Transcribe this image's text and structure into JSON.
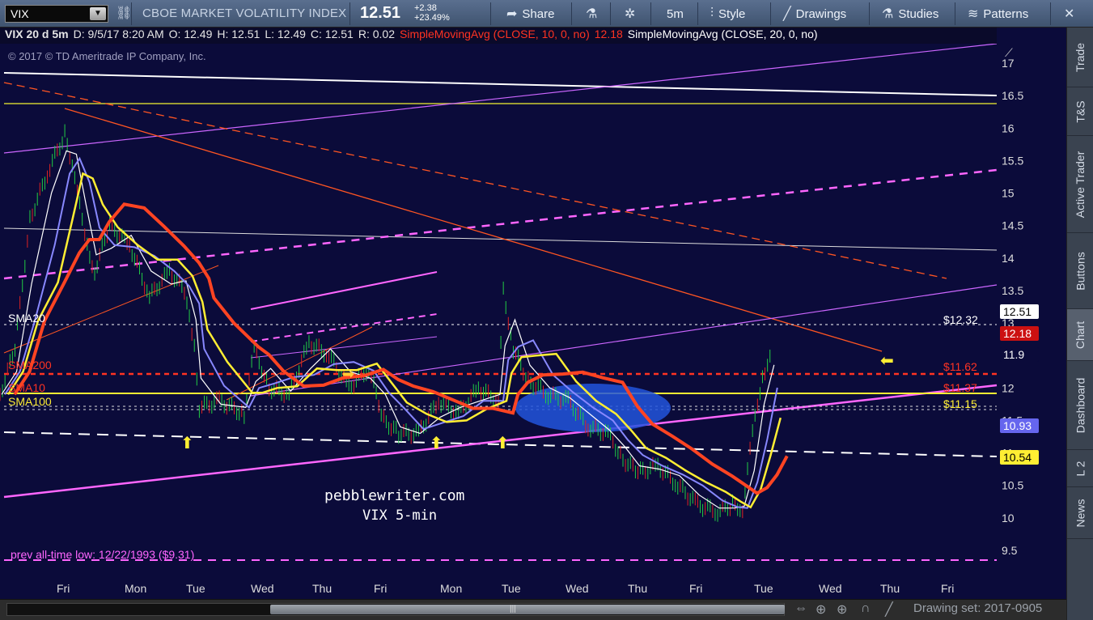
{
  "toolbar": {
    "symbol": "VIX",
    "description": "CBOE MARKET VOLATILITY INDEX",
    "last": "12.51",
    "change_abs": "+2.38",
    "change_pct": "+23.49%",
    "share": "Share",
    "aggregation": "5m",
    "style": "Style",
    "drawings": "Drawings",
    "studies": "Studies",
    "patterns": "Patterns",
    "share_icon": "share-arrow-icon",
    "flask_icon": "flask-icon",
    "gear_icon": "gear-icon",
    "style_icon": "candlestick-icon",
    "drawings_icon": "pencil-icon",
    "studies_icon": "beaker-icon",
    "patterns_icon": "patterns-icon",
    "close_icon": "close-icon"
  },
  "infobar": {
    "title": "VIX 20 d 5m",
    "date": "D: 9/5/17 8:20 AM",
    "open": "O: 12.49",
    "high": "H: 12.51",
    "low": "L: 12.49",
    "close": "C: 12.51",
    "range": "R: 0.02",
    "sma10_label": "SimpleMovingAvg (CLOSE, 10, 0, no)",
    "sma10_value": "12.18",
    "sma20_label": "SimpleMovingAvg (CLOSE, 20, 0, no)"
  },
  "copyright": "© 2017 © TD Ameritrade IP Company, Inc.",
  "colors": {
    "background": "#0b0b3a",
    "sma10": "#ff3322",
    "sma20": "#ffffff",
    "sma50": "#8888ff",
    "sma100": "#ffee33",
    "sma200": "#ff4422",
    "magenta": "#ff66ff",
    "price_up": "#22cc44",
    "price_down": "#dd2222"
  },
  "chart_data": {
    "type": "candlestick",
    "symbol": "VIX",
    "timeframe": "5m",
    "ylim": [
      9.1,
      17.3
    ],
    "y_ticks": [
      "17",
      "16.5",
      "16",
      "15.5",
      "15",
      "14.5",
      "14",
      "13.5",
      "13",
      "12.5",
      "12",
      "11.5",
      "11",
      "10.5",
      "10",
      "9.5"
    ],
    "x_ticks": [
      "Fri",
      "Mon",
      "Tue",
      "Wed",
      "Thu",
      "Fri",
      "Mon",
      "Tue",
      "Wed",
      "Thu",
      "Fri",
      "Tue",
      "Wed",
      "Thu",
      "Fri"
    ],
    "price_path": [
      [
        0,
        11.9
      ],
      [
        0.015,
        12.6
      ],
      [
        0.03,
        14.6
      ],
      [
        0.05,
        15.4
      ],
      [
        0.065,
        15.9
      ],
      [
        0.075,
        15.3
      ],
      [
        0.085,
        14.3
      ],
      [
        0.095,
        13.8
      ],
      [
        0.11,
        14.5
      ],
      [
        0.13,
        14.2
      ],
      [
        0.15,
        13.4
      ],
      [
        0.17,
        13.8
      ],
      [
        0.185,
        13.5
      ],
      [
        0.195,
        12.6
      ],
      [
        0.2,
        11.7
      ],
      [
        0.22,
        11.8
      ],
      [
        0.245,
        11.6
      ],
      [
        0.255,
        12.6
      ],
      [
        0.27,
        12.0
      ],
      [
        0.29,
        11.9
      ],
      [
        0.31,
        12.7
      ],
      [
        0.33,
        12.5
      ],
      [
        0.35,
        12.0
      ],
      [
        0.37,
        12.3
      ],
      [
        0.385,
        11.5
      ],
      [
        0.4,
        11.3
      ],
      [
        0.42,
        11.3
      ],
      [
        0.44,
        11.8
      ],
      [
        0.46,
        11.6
      ],
      [
        0.48,
        12.0
      ],
      [
        0.5,
        11.8
      ],
      [
        0.505,
        13.5
      ],
      [
        0.515,
        12.6
      ],
      [
        0.53,
        12.1
      ],
      [
        0.55,
        11.9
      ],
      [
        0.57,
        11.8
      ],
      [
        0.59,
        11.4
      ],
      [
        0.61,
        11.3
      ],
      [
        0.625,
        10.9
      ],
      [
        0.64,
        10.7
      ],
      [
        0.66,
        10.8
      ],
      [
        0.68,
        10.5
      ],
      [
        0.7,
        10.2
      ],
      [
        0.72,
        10.1
      ],
      [
        0.735,
        10.2
      ],
      [
        0.745,
        10.15
      ],
      [
        0.755,
        11.3
      ],
      [
        0.765,
        12.2
      ],
      [
        0.775,
        12.51
      ]
    ],
    "series": [
      {
        "name": "SMA20",
        "value_label": "$12.32",
        "value": 12.32
      },
      {
        "name": "SMA200",
        "value_label": "$11.62",
        "value": 11.62
      },
      {
        "name": "SMA10",
        "value_label": "$11.37",
        "value": 11.37
      },
      {
        "name": "SMA100",
        "value_label": "$11.15",
        "value": 11.15
      }
    ],
    "price_bubbles": [
      {
        "label": "12.51",
        "value": 12.51
      },
      {
        "label": "12.18",
        "value": 12.18
      },
      {
        "label": "11.9",
        "value": 11.9
      },
      {
        "label": "10.93",
        "value": 10.93
      },
      {
        "label": "10.54",
        "value": 10.54
      }
    ],
    "annotations": {
      "watermark_site": "pebblewriter.com",
      "watermark_sub": "VIX 5-min",
      "prev_low": "prev all-time low: 12/22/1993 ($9.31)"
    }
  },
  "sidebar": {
    "tabs": [
      "Trade",
      "T&S",
      "Active Trader",
      "Buttons",
      "Chart",
      "Dashboard",
      "L 2",
      "News"
    ],
    "active": "Chart"
  },
  "bottombar": {
    "drawing_set": "Drawing set: 2017-0905"
  }
}
